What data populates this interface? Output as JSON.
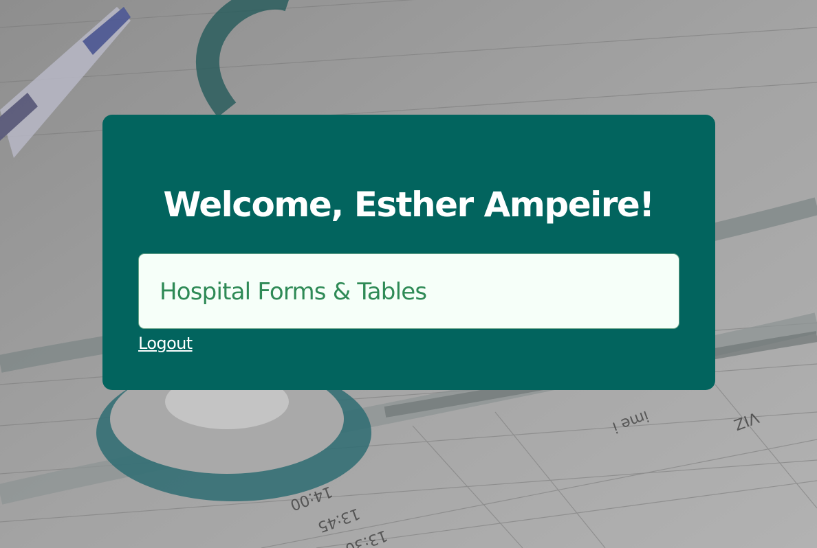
{
  "page": {
    "welcome_heading": "Welcome, Esther Ampeire!",
    "forms_button_label": "Hospital Forms & Tables",
    "logout_link_label": "Logout"
  },
  "colors": {
    "card_background": "#02645e",
    "button_background": "#f6fff9",
    "button_text": "#2e8a56",
    "heading_text": "#ffffff"
  }
}
